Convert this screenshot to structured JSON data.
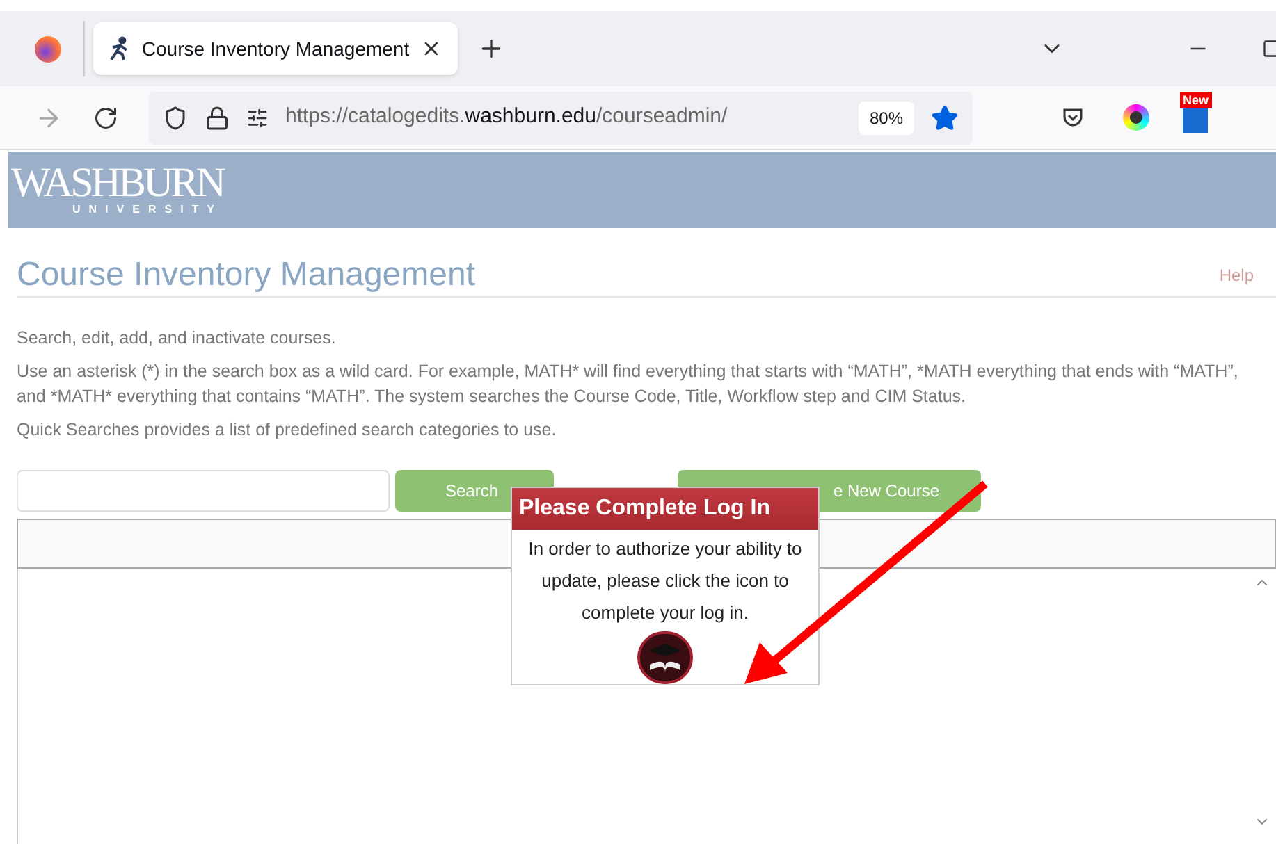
{
  "browser": {
    "tab_title": "Course Inventory Management",
    "address": {
      "prefix": "https://catalogedits.",
      "domain": "washburn.edu",
      "path": "/courseadmin/"
    },
    "zoom": "80%",
    "badge": "New"
  },
  "banner": {
    "logo": "WASHBURN",
    "logo_sub": "UNIVERSITY"
  },
  "page": {
    "title": "Course Inventory Management",
    "help": "Help",
    "description": [
      "Search, edit, add, and inactivate courses.",
      "Use an asterisk (*) in the search box as a wild card. For example, MATH* will find everything that starts with “MATH”, *MATH everything that ends with “MATH”, and *MATH* everything that contains “MATH”. The system searches the Course Code, Title, Workflow step and CIM Status.",
      "Quick Searches provides a list of predefined search categories to use."
    ],
    "search_button": "Search",
    "new_course_button": "e New Course"
  },
  "popup": {
    "title": "Please Complete Log In",
    "message": "In order to authorize your ability to update, please click the icon to complete your log in."
  }
}
